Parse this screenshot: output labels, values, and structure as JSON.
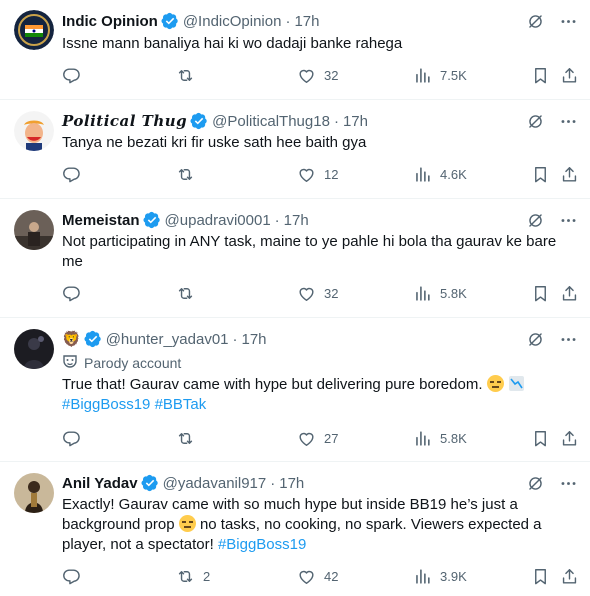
{
  "tweets": [
    {
      "name": "Indic Opinion",
      "handle": "@IndicOpinion",
      "time": "17h",
      "text": "Issne mann banaliya hai ki wo dadaji banke rahega",
      "stats": {
        "replies": "",
        "retweets": "",
        "likes": "32",
        "views": "7.5K"
      }
    },
    {
      "name": "Political Thug",
      "handle": "@PoliticalThug18",
      "time": "17h",
      "text": "Tanya ne bezati kri fir uske sath hee baith gya",
      "stats": {
        "replies": "",
        "retweets": "",
        "likes": "12",
        "views": "4.6K"
      }
    },
    {
      "name": "Memeistan",
      "handle": "@upadravi0001",
      "time": "17h",
      "text": "Not participating in ANY task, maine to ye pahle hi bola tha gaurav ke bare me",
      "stats": {
        "replies": "",
        "retweets": "",
        "likes": "32",
        "views": "5.8K"
      }
    },
    {
      "name": "🦁",
      "handle": "@hunter_yadav01",
      "time": "17h",
      "parody_label": "Parody account",
      "text": "True that! Gaurav came with hype but delivering pure boredom.",
      "hashtags": "#BiggBoss19 #BBTak",
      "stats": {
        "replies": "",
        "retweets": "",
        "likes": "27",
        "views": "5.8K"
      }
    },
    {
      "name": "Anil Yadav",
      "handle": "@yadavanil917",
      "time": "17h",
      "text_part1": "Exactly! Gaurav came with so much hype but inside BB19 he’s just a background prop",
      "text_part2": "no tasks, no cooking, no spark. Viewers expected a player, not a spectator!",
      "hashtags": "#BiggBoss19",
      "stats": {
        "replies": "",
        "retweets": "2",
        "likes": "42",
        "views": "3.9K"
      }
    }
  ],
  "icons": {
    "verified_color": "#1d9bf0",
    "icon_color": "#536471",
    "hashtag_color": "#1d9bf0"
  }
}
